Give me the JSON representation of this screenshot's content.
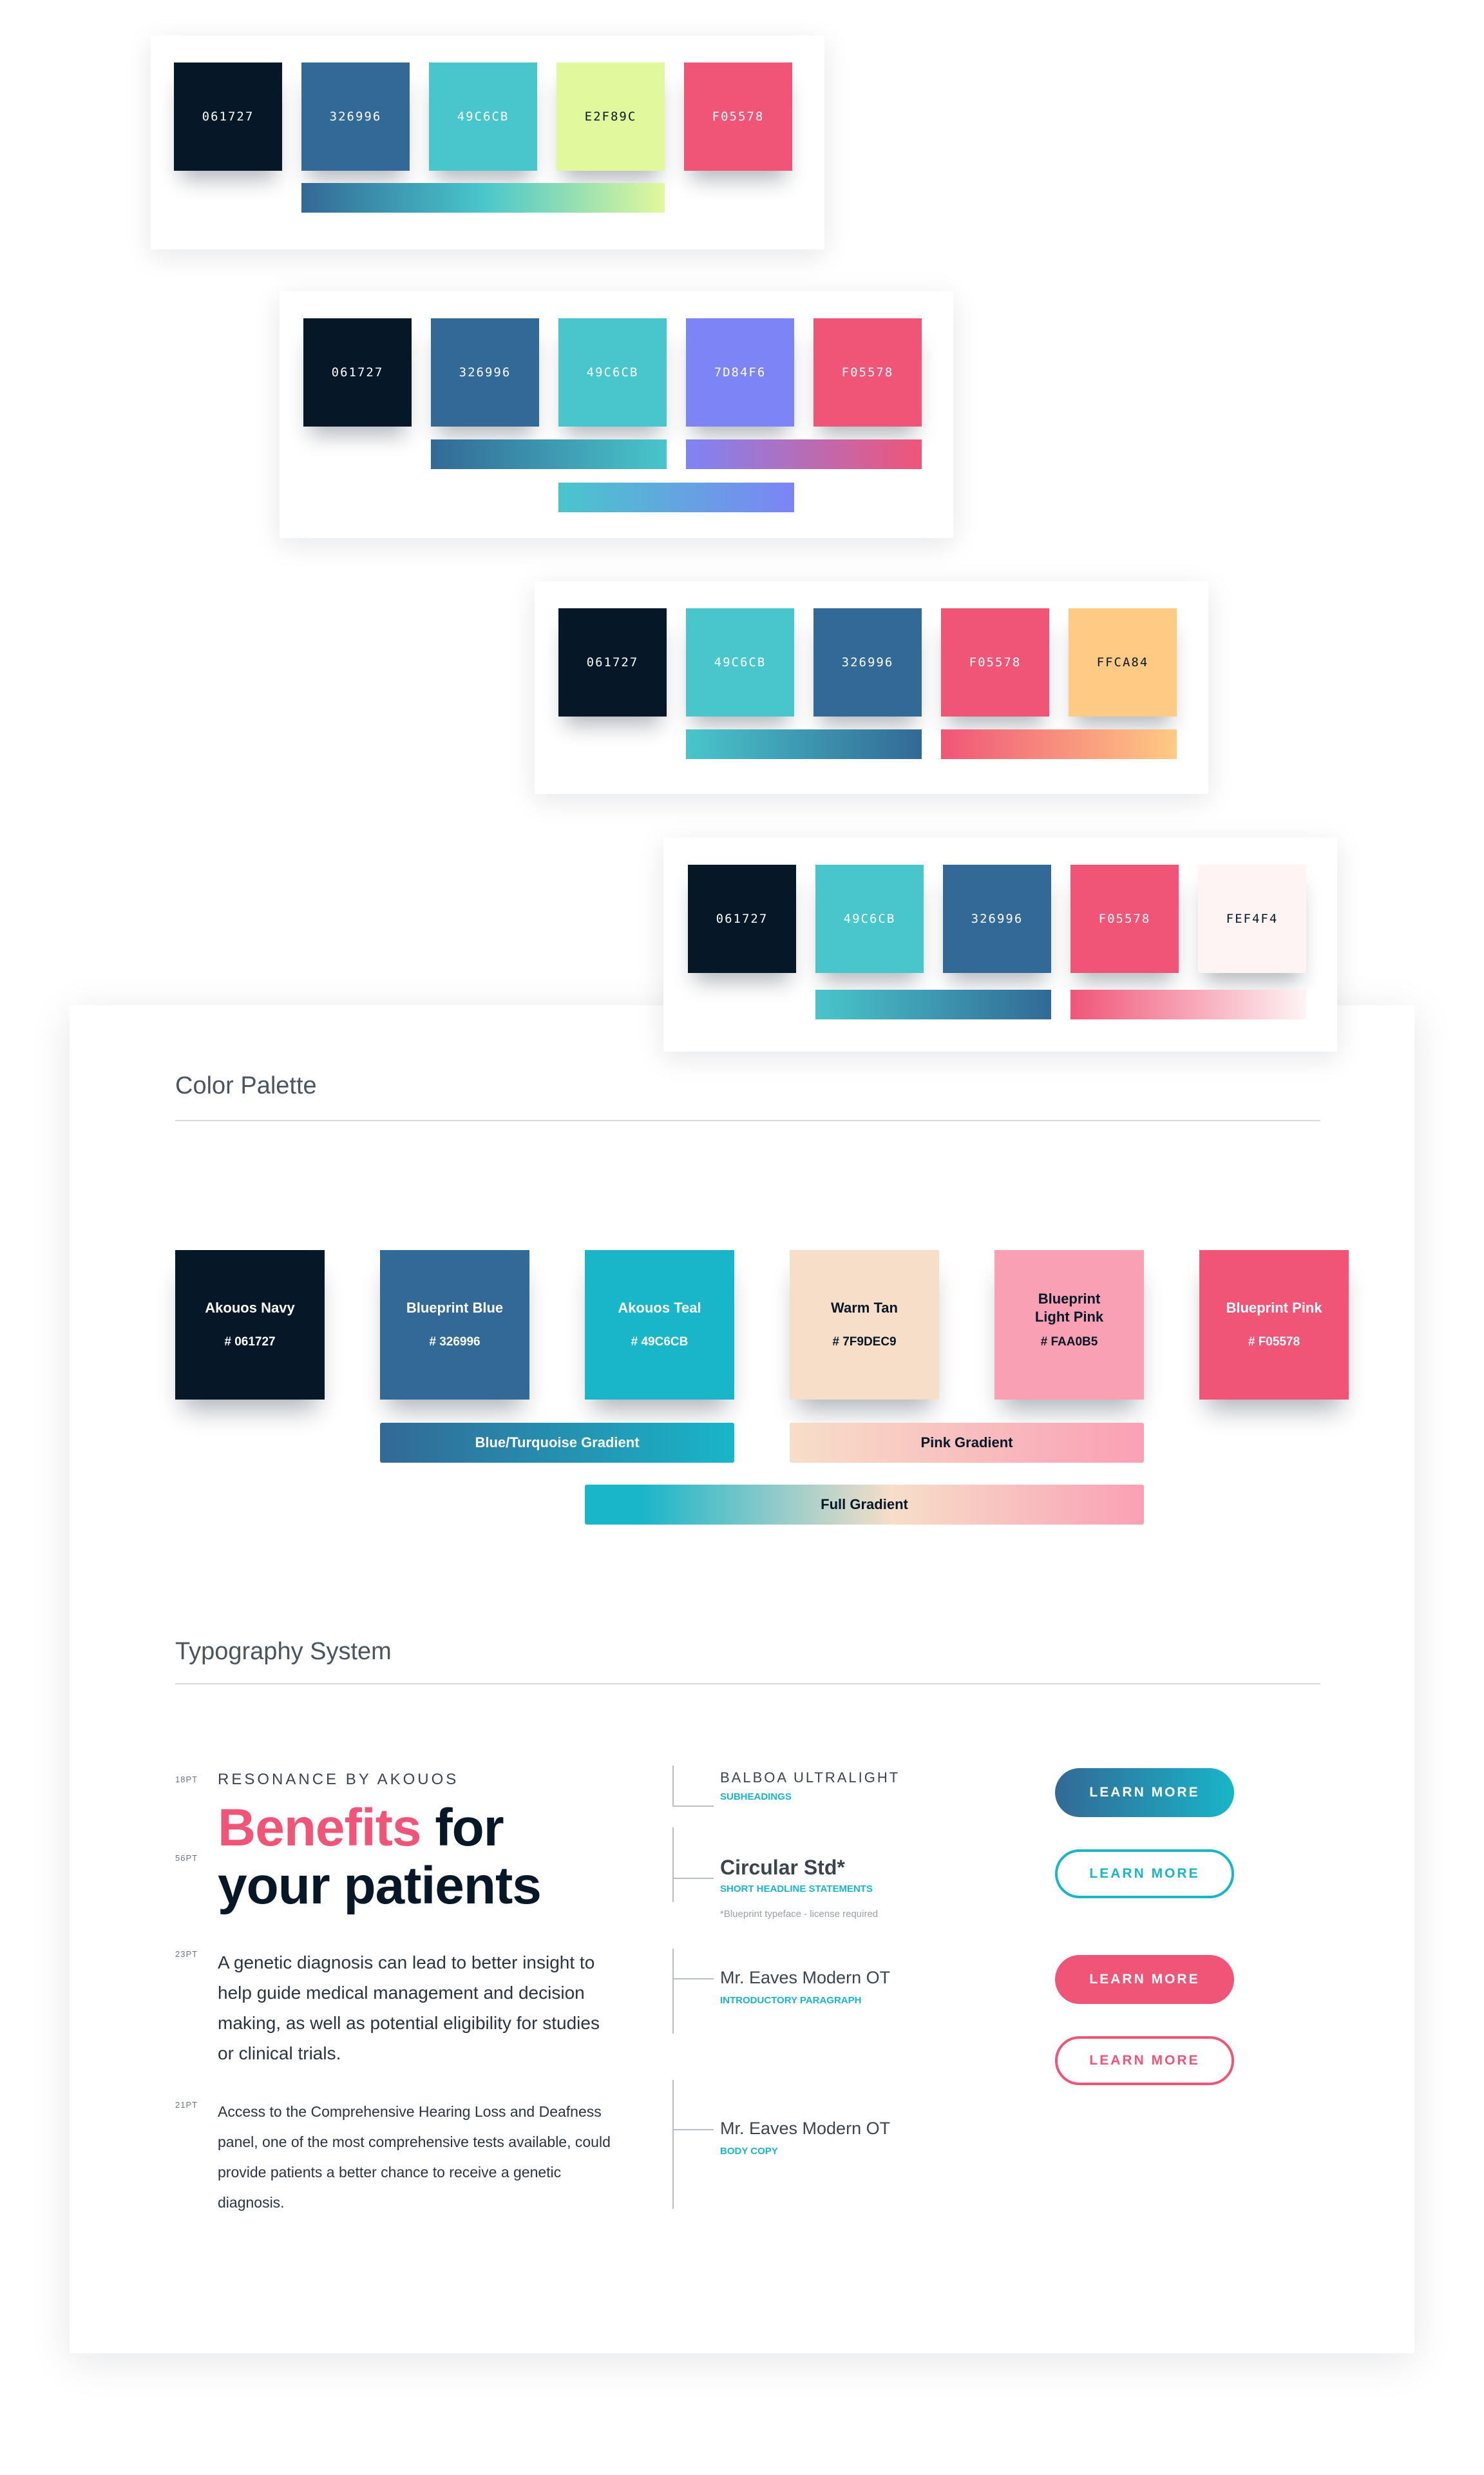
{
  "explorations": [
    {
      "swatches": [
        {
          "hex": "061727",
          "color": "#061727",
          "text_color": "#ffffff"
        },
        {
          "hex": "326996",
          "color": "#326996",
          "text_color": "#ffffff"
        },
        {
          "hex": "49C6CB",
          "color": "#49C6CB",
          "text_color": "#ffffff"
        },
        {
          "hex": "E2F89C",
          "color": "#E2F89C",
          "text_color": "#061727"
        },
        {
          "hex": "F05578",
          "color": "#F05578",
          "text_color": "#ffffff"
        }
      ]
    },
    {
      "swatches": [
        {
          "hex": "061727",
          "color": "#061727",
          "text_color": "#ffffff"
        },
        {
          "hex": "326996",
          "color": "#326996",
          "text_color": "#ffffff"
        },
        {
          "hex": "49C6CB",
          "color": "#49C6CB",
          "text_color": "#ffffff"
        },
        {
          "hex": "7D84F6",
          "color": "#7D84F6",
          "text_color": "#ffffff"
        },
        {
          "hex": "F05578",
          "color": "#F05578",
          "text_color": "#ffffff"
        }
      ]
    },
    {
      "swatches": [
        {
          "hex": "061727",
          "color": "#061727",
          "text_color": "#ffffff"
        },
        {
          "hex": "49C6CB",
          "color": "#49C6CB",
          "text_color": "#ffffff"
        },
        {
          "hex": "326996",
          "color": "#326996",
          "text_color": "#ffffff"
        },
        {
          "hex": "F05578",
          "color": "#F05578",
          "text_color": "#ffffff"
        },
        {
          "hex": "FFCA84",
          "color": "#FFCA84",
          "text_color": "#061727"
        }
      ]
    },
    {
      "swatches": [
        {
          "hex": "061727",
          "color": "#061727",
          "text_color": "#ffffff"
        },
        {
          "hex": "49C6CB",
          "color": "#49C6CB",
          "text_color": "#ffffff"
        },
        {
          "hex": "326996",
          "color": "#326996",
          "text_color": "#ffffff"
        },
        {
          "hex": "F05578",
          "color": "#F05578",
          "text_color": "#ffffff"
        },
        {
          "hex": "FEF4F4",
          "color": "#FEF4F4",
          "text_color": "#061727"
        }
      ]
    }
  ],
  "color_palette": {
    "title": "Color Palette",
    "colors": [
      {
        "name": "Akouos Navy",
        "hex": "# 061727",
        "color": "#061727",
        "text_color": "#ffffff"
      },
      {
        "name": "Blueprint Blue",
        "hex": "# 326996",
        "color": "#326996",
        "text_color": "#ffffff"
      },
      {
        "name": "Akouos Teal",
        "hex": "# 49C6CB",
        "color": "#19B5C9",
        "text_color": "#ffffff"
      },
      {
        "name": "Warm Tan",
        "hex": "# 7F9DEC9",
        "color": "#F7DEC9",
        "text_color": "#061727"
      },
      {
        "name": "Blueprint Light Pink",
        "hex": "# FAA0B5",
        "color": "#FAA0B5",
        "text_color": "#061727"
      },
      {
        "name": "Blueprint Pink",
        "hex": "# F05578",
        "color": "#F05578",
        "text_color": "#ffffff"
      }
    ],
    "gradients": {
      "blue_turquoise": "Blue/Turquoise Gradient",
      "pink": "Pink Gradient",
      "full": "Full Gradient"
    }
  },
  "typography": {
    "title": "Typography System",
    "sizes": {
      "eyebrow": "18PT",
      "headline": "56PT",
      "intro": "23PT",
      "body": "21PT"
    },
    "eyebrow": "RESONANCE BY AKOUOS",
    "headline": {
      "accent": "Benefits",
      "rest_line1": "for",
      "line2": "your patients"
    },
    "intro_text": "A genetic diagnosis can lead to better insight to help guide medical management and decision making, as well as potential eligibility for studies or clinical trials.",
    "body_text": "Access to the Comprehensive Hearing Loss and Deafness panel, one of the most comprehensive tests available, could provide patients a better chance to receive a genetic diagnosis.",
    "specs": [
      {
        "font": "BALBOA ULTRALIGHT",
        "usage": "SUBHEADINGS"
      },
      {
        "font": "Circular Std*",
        "usage": "SHORT HEADLINE STATEMENTS",
        "note": "*Blueprint typeface - license required"
      },
      {
        "font": "Mr. Eaves Modern OT",
        "usage": "INTRODUCTORY PARAGRAPH"
      },
      {
        "font": "Mr. Eaves Modern OT",
        "usage": "BODY COPY"
      }
    ],
    "buttons": [
      {
        "label": "LEARN MORE",
        "style": "filled-gradient"
      },
      {
        "label": "LEARN MORE",
        "style": "outline-teal"
      },
      {
        "label": "LEARN MORE",
        "style": "filled-pink"
      },
      {
        "label": "LEARN MORE",
        "style": "outline-pink"
      }
    ]
  }
}
